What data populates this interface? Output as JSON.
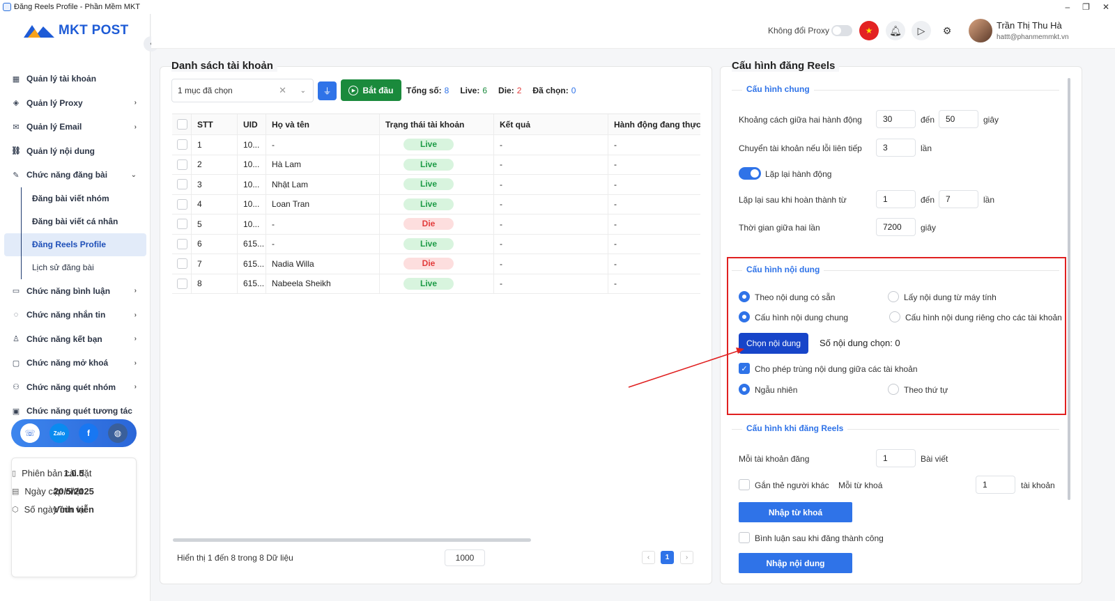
{
  "window": {
    "title": "Đăng Reels Profile - Phần Mềm MKT",
    "controls": [
      "–",
      "❐",
      "✕"
    ]
  },
  "brand": {
    "name": "MKT POST",
    "colors": {
      "primary": "#1e5bd6",
      "accent": "#f7a21b"
    }
  },
  "sidebar": {
    "items": [
      {
        "label": "Quản lý tài khoản",
        "icon": "grid-icon",
        "chevron": ""
      },
      {
        "label": "Quản lý Proxy",
        "icon": "layers-icon",
        "chevron": "›"
      },
      {
        "label": "Quản lý Email",
        "icon": "mail-icon",
        "chevron": "›"
      },
      {
        "label": "Quản lý nội dung",
        "icon": "link-icon",
        "chevron": ""
      },
      {
        "label": "Chức năng đăng bài",
        "icon": "edit-icon",
        "chevron": "⌄"
      }
    ],
    "sub_items": [
      {
        "label": "Đăng bài viết nhóm"
      },
      {
        "label": "Đăng bài viết cá nhân"
      },
      {
        "label": "Đăng Reels Profile"
      },
      {
        "label": "Lịch sử đăng bài"
      }
    ],
    "items2": [
      {
        "label": "Chức năng bình luận",
        "icon": "comment-icon",
        "chevron": "›"
      },
      {
        "label": "Chức năng nhắn tin",
        "icon": "chat-icon",
        "chevron": "›"
      },
      {
        "label": "Chức năng kết bạn",
        "icon": "user-plus-icon",
        "chevron": "›"
      },
      {
        "label": "Chức năng mở khoá",
        "icon": "lock-icon",
        "chevron": "›"
      },
      {
        "label": "Chức năng quét nhóm",
        "icon": "group-icon",
        "chevron": "›"
      },
      {
        "label": "Chức năng quét tương tác",
        "icon": "scan-icon",
        "chevron": ""
      }
    ],
    "social": {
      "zalo": "Zalo"
    },
    "info": {
      "version_label": "Phiên bản cài đặt",
      "version": "1.0.5",
      "updated_label": "Ngày cập nhật",
      "updated": "20/5/2025",
      "days_label": "Số ngày còn lại",
      "days": "Vĩnh viễn"
    }
  },
  "topbar": {
    "proxy_label": "Không đổi Proxy",
    "user_name": "Trần Thị Thu Hà",
    "user_email": "hattt@phanmemmkt.vn"
  },
  "accounts": {
    "title": "Danh sách tài khoản",
    "filter_value": "1 mục đã chọn",
    "start_label": "Bắt đầu",
    "stats": {
      "total_label": "Tổng số:",
      "total": "8",
      "live_label": "Live:",
      "live": "6",
      "die_label": "Die:",
      "die": "2",
      "selected_label": "Đã chọn:",
      "selected": "0"
    },
    "columns": [
      "STT",
      "UID",
      "Họ và tên",
      "Trạng thái tài khoản",
      "Kết quả",
      "Hành động đang thực h"
    ],
    "rows": [
      {
        "stt": "1",
        "uid": "10...",
        "name": "-",
        "status": "Live",
        "result": "-",
        "action": "-"
      },
      {
        "stt": "2",
        "uid": "10...",
        "name": "Hà Lam",
        "status": "Live",
        "result": "-",
        "action": "-"
      },
      {
        "stt": "3",
        "uid": "10...",
        "name": "Nhật Lam",
        "status": "Live",
        "result": "-",
        "action": "-"
      },
      {
        "stt": "4",
        "uid": "10...",
        "name": "Loan Tran",
        "status": "Live",
        "result": "-",
        "action": "-"
      },
      {
        "stt": "5",
        "uid": "10...",
        "name": "-",
        "status": "Die",
        "result": "-",
        "action": "-"
      },
      {
        "stt": "6",
        "uid": "615...",
        "name": "-",
        "status": "Live",
        "result": "-",
        "action": "-"
      },
      {
        "stt": "7",
        "uid": "615...",
        "name": "Nadia Willa",
        "status": "Die",
        "result": "-",
        "action": "-"
      },
      {
        "stt": "8",
        "uid": "615...",
        "name": "Nabeela Sheikh",
        "status": "Live",
        "result": "-",
        "action": "-"
      }
    ],
    "footer_text": "Hiển thị 1 đến 8 trong 8 Dữ liệu",
    "page_size": "1000",
    "page_current": "1",
    "prev": "‹",
    "next": "›"
  },
  "config": {
    "title": "Cấu hình đăng Reels",
    "general": {
      "title": "Cấu hình chung",
      "gap_label": "Khoảng cách giữa hai hành động",
      "gap_from": "30",
      "to": "đến",
      "gap_to": "50",
      "sec": "giây",
      "switch_label": "Chuyển tài khoản nếu lỗi liên tiếp",
      "switch_value": "3",
      "times": "lần",
      "repeat_label": "Lặp lại hành động",
      "repeat_after_label": "Lặp lại sau khi hoàn thành từ",
      "repeat_from": "1",
      "repeat_to": "7",
      "interval_label": "Thời gian giữa hai lần",
      "interval": "7200"
    },
    "content": {
      "title": "Cấu hình nội dung",
      "opt_existing": "Theo nội dung có sẵn",
      "opt_computer": "Lấy nội dung từ máy tính",
      "opt_common": "Cấu hình nội dung chung",
      "opt_separate": "Cấu hình nội dung riêng cho các tài khoản",
      "choose_btn": "Chọn nội dung",
      "count_label": "Số nội dung chọn: 0",
      "allow_dup": "Cho phép trùng nội dung giữa các tài khoản",
      "random": "Ngẫu nhiên",
      "sequential": "Theo thứ tự"
    },
    "reels": {
      "title": "Cấu hình khi đăng Reels",
      "per_account_label": "Mỗi tài khoản đăng",
      "per_account": "1",
      "posts": "Bài viết",
      "tag_label": "Gắn thẻ người khác",
      "keyword_label": "Mỗi từ khoá",
      "keyword_value": "1",
      "accounts": "tài khoản",
      "import_keyword_btn": "Nhập từ khoá",
      "comment_label": "Bình luận sau khi đăng thành công",
      "import_content_btn": "Nhập nội dung"
    }
  }
}
